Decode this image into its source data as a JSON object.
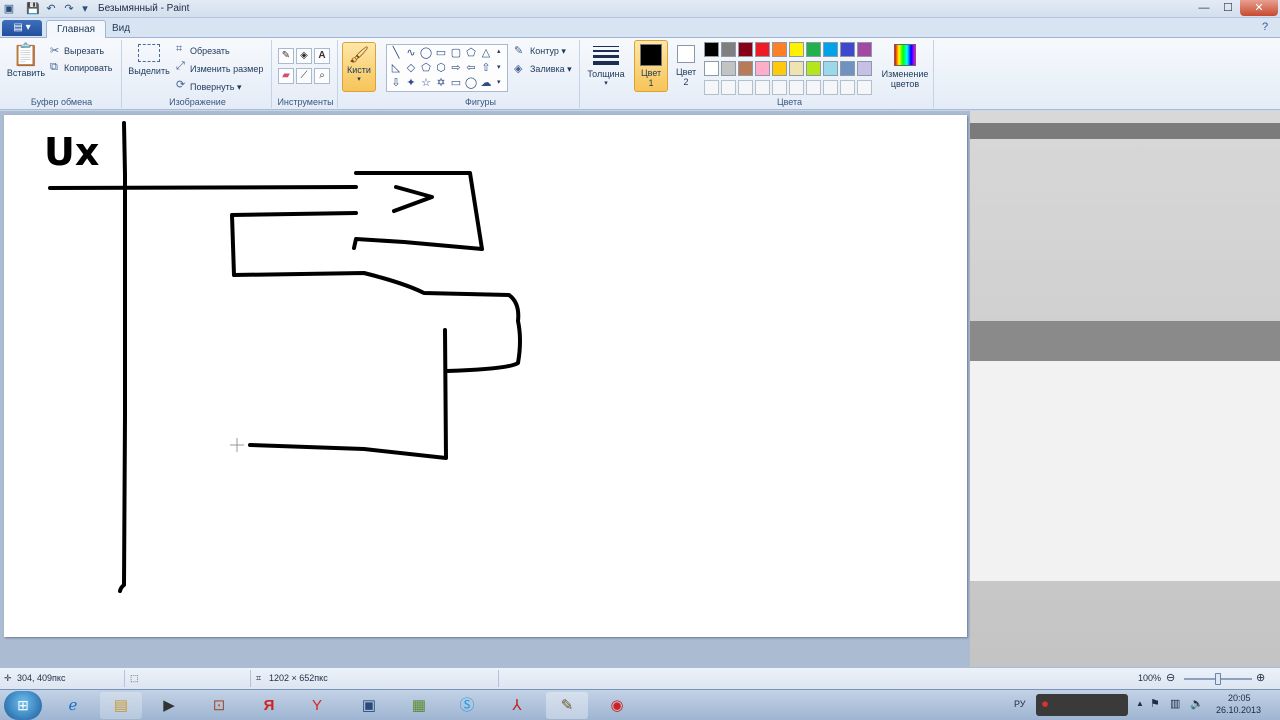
{
  "window": {
    "title": "Безымянный - Paint",
    "controls": {
      "minimize": "—",
      "maximize": "☐",
      "close": "✕"
    }
  },
  "tabs": {
    "menu": "▤ ▾",
    "items": [
      "Главная",
      "Вид"
    ]
  },
  "ribbon": {
    "clipboard": {
      "label": "Буфер обмена",
      "paste": "Вставить",
      "cut": "Вырезать",
      "copy": "Копировать"
    },
    "image": {
      "label": "Изображение",
      "select": "Выделить",
      "crop": "Обрезать",
      "resize": "Изменить размер",
      "rotate": "Повернуть ▾"
    },
    "tools": {
      "label": "Инструменты"
    },
    "brushes": {
      "label": "Кисти"
    },
    "shapes": {
      "label": "Фигуры",
      "outline": "Контур ▾",
      "fill": "Заливка ▾"
    },
    "thickness": {
      "label": "Толщина"
    },
    "color1": {
      "label": "Цвет 1"
    },
    "color2": {
      "label": "Цвет 2"
    },
    "colors": {
      "label": "Цвета",
      "edit": "Изменение цветов",
      "row1": [
        "#000000",
        "#7f7f7f",
        "#880015",
        "#ed1c24",
        "#ff7f27",
        "#fff200",
        "#22b14c",
        "#00a2e8",
        "#3f48cc",
        "#a349a4"
      ],
      "row2": [
        "#ffffff",
        "#c3c3c3",
        "#b97a57",
        "#ffaec9",
        "#ffc90e",
        "#efe4b0",
        "#b5e61d",
        "#99d9ea",
        "#7092be",
        "#c8bfe7"
      ]
    }
  },
  "canvas": {
    "text": "Ux"
  },
  "statusbar": {
    "cursor": "304, 409пкс",
    "size": "1202 × 652пкс",
    "zoom": "100%",
    "zoom_level": 1.0
  },
  "taskbar": {
    "lang": "РУ",
    "time": "20:05",
    "date": "26.10.2013"
  }
}
